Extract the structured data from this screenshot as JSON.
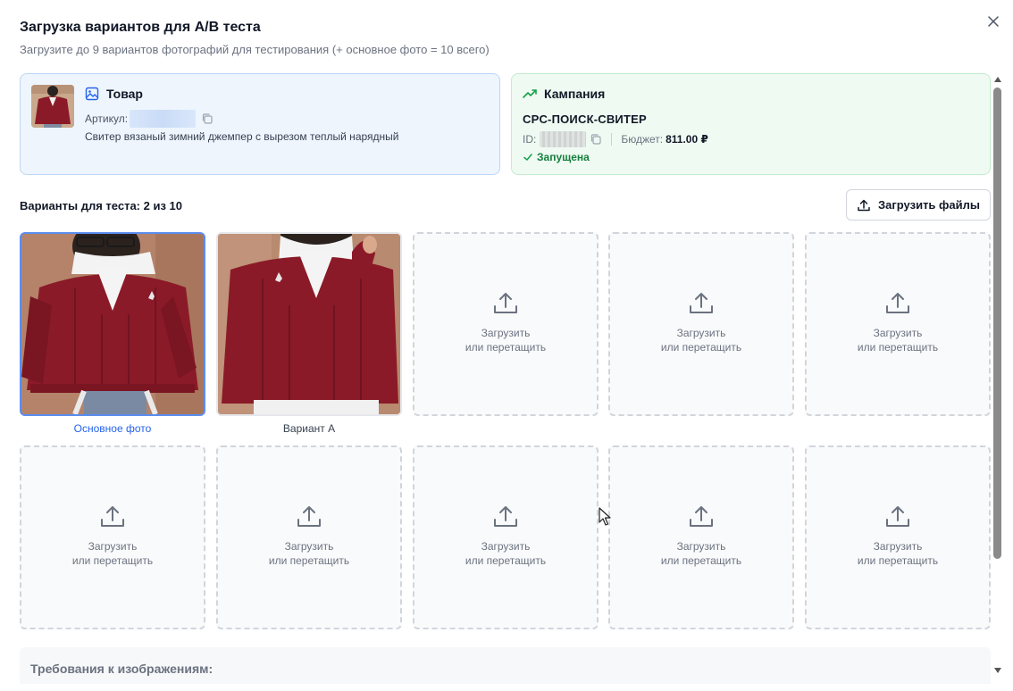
{
  "dialog": {
    "title": "Загрузка вариантов для А/В теста",
    "subtitle": "Загрузите до 9 вариантов фотографий для тестирования (+ основное фото = 10 всего)"
  },
  "product": {
    "heading": "Товар",
    "artikul_label": "Артикул:",
    "description": "Свитер вязаный зимний джемпер с вырезом теплый нарядный"
  },
  "campaign": {
    "heading": "Кампания",
    "name": "CPC-ПОИСК-СВИТЕР",
    "id_label": "ID:",
    "budget_label": "Бюджет:",
    "budget_value": "811.00 ₽",
    "status": "Запущена",
    "status_color": "#15803d"
  },
  "variants": {
    "label": "Варианты для теста: 2 из 10",
    "upload_button": "Загрузить файлы",
    "primary_caption": "Основное фото",
    "variant_a_caption": "Вариант А",
    "empty_line1": "Загрузить",
    "empty_line2": "или перетащить"
  },
  "requirements": {
    "title": "Требования к изображениям:"
  },
  "colors": {
    "accent": "#2563eb",
    "product_bg": "#eef5fd",
    "campaign_bg": "#effaf2",
    "sweater": "#8b1a28"
  }
}
